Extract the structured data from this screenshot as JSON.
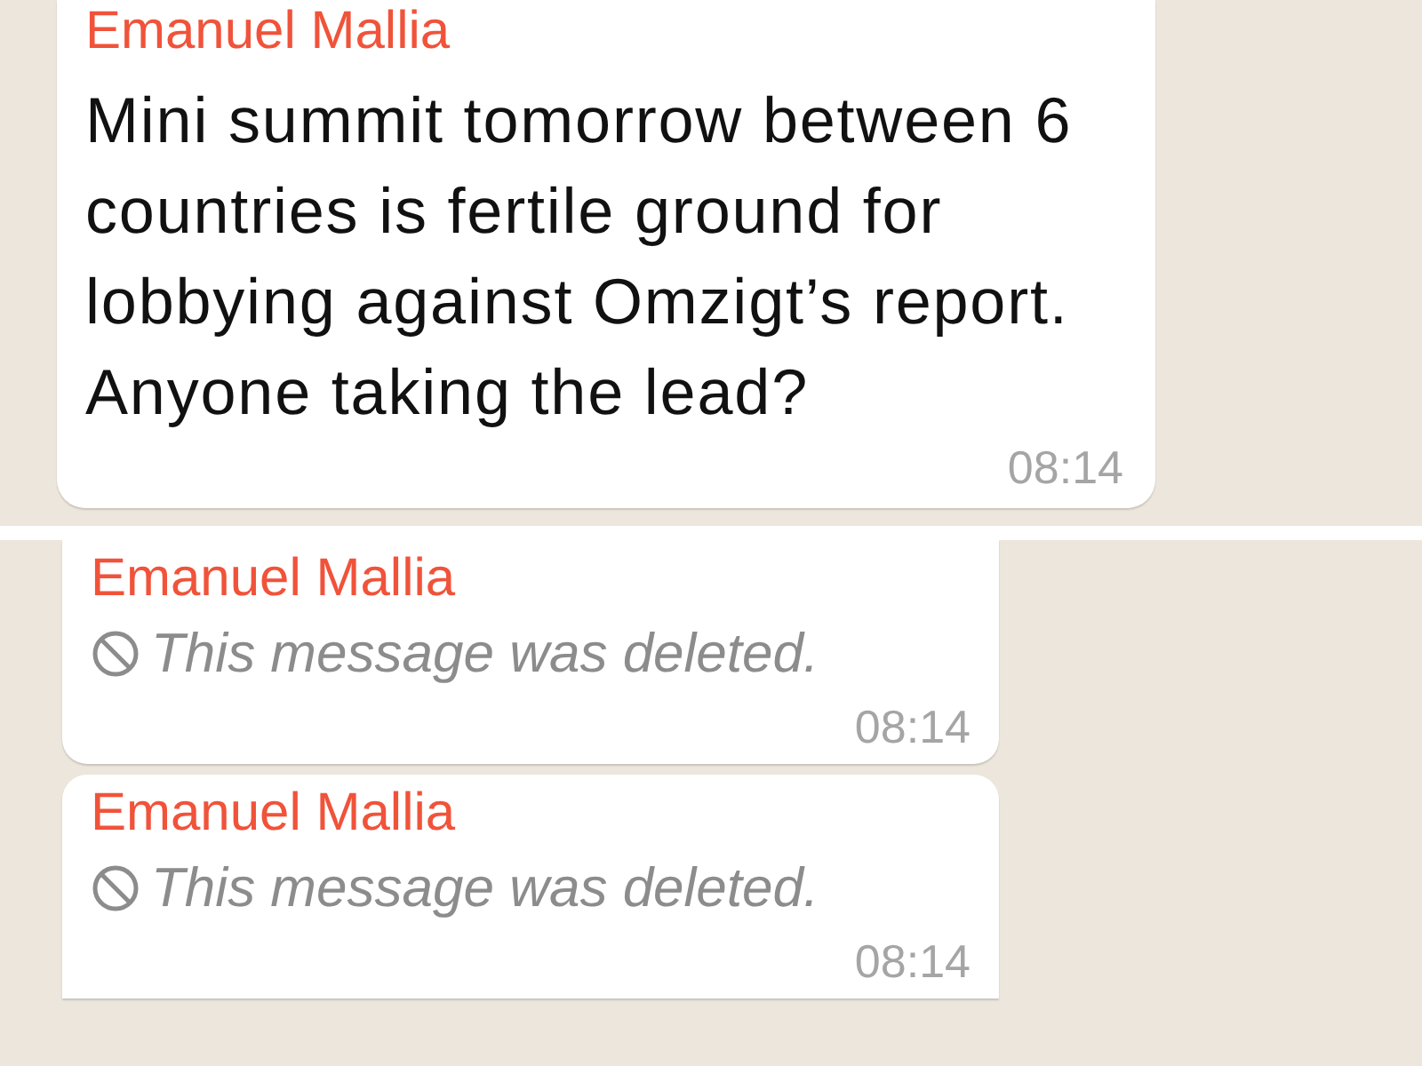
{
  "panels": [
    {
      "messages": [
        {
          "sender": "Emanuel Mallia",
          "text": "Mini summit tomorrow between 6 countries is fertile ground for lobbying against Omzigt’s report. Anyone taking the lead?",
          "time": "08:14",
          "deleted": false
        }
      ]
    },
    {
      "messages": [
        {
          "sender": "Emanuel Mallia",
          "text": "This message was deleted.",
          "time": "08:14",
          "deleted": true
        },
        {
          "sender": "Emanuel Mallia",
          "text": "This message was deleted.",
          "time": "08:14",
          "deleted": true
        }
      ]
    }
  ]
}
